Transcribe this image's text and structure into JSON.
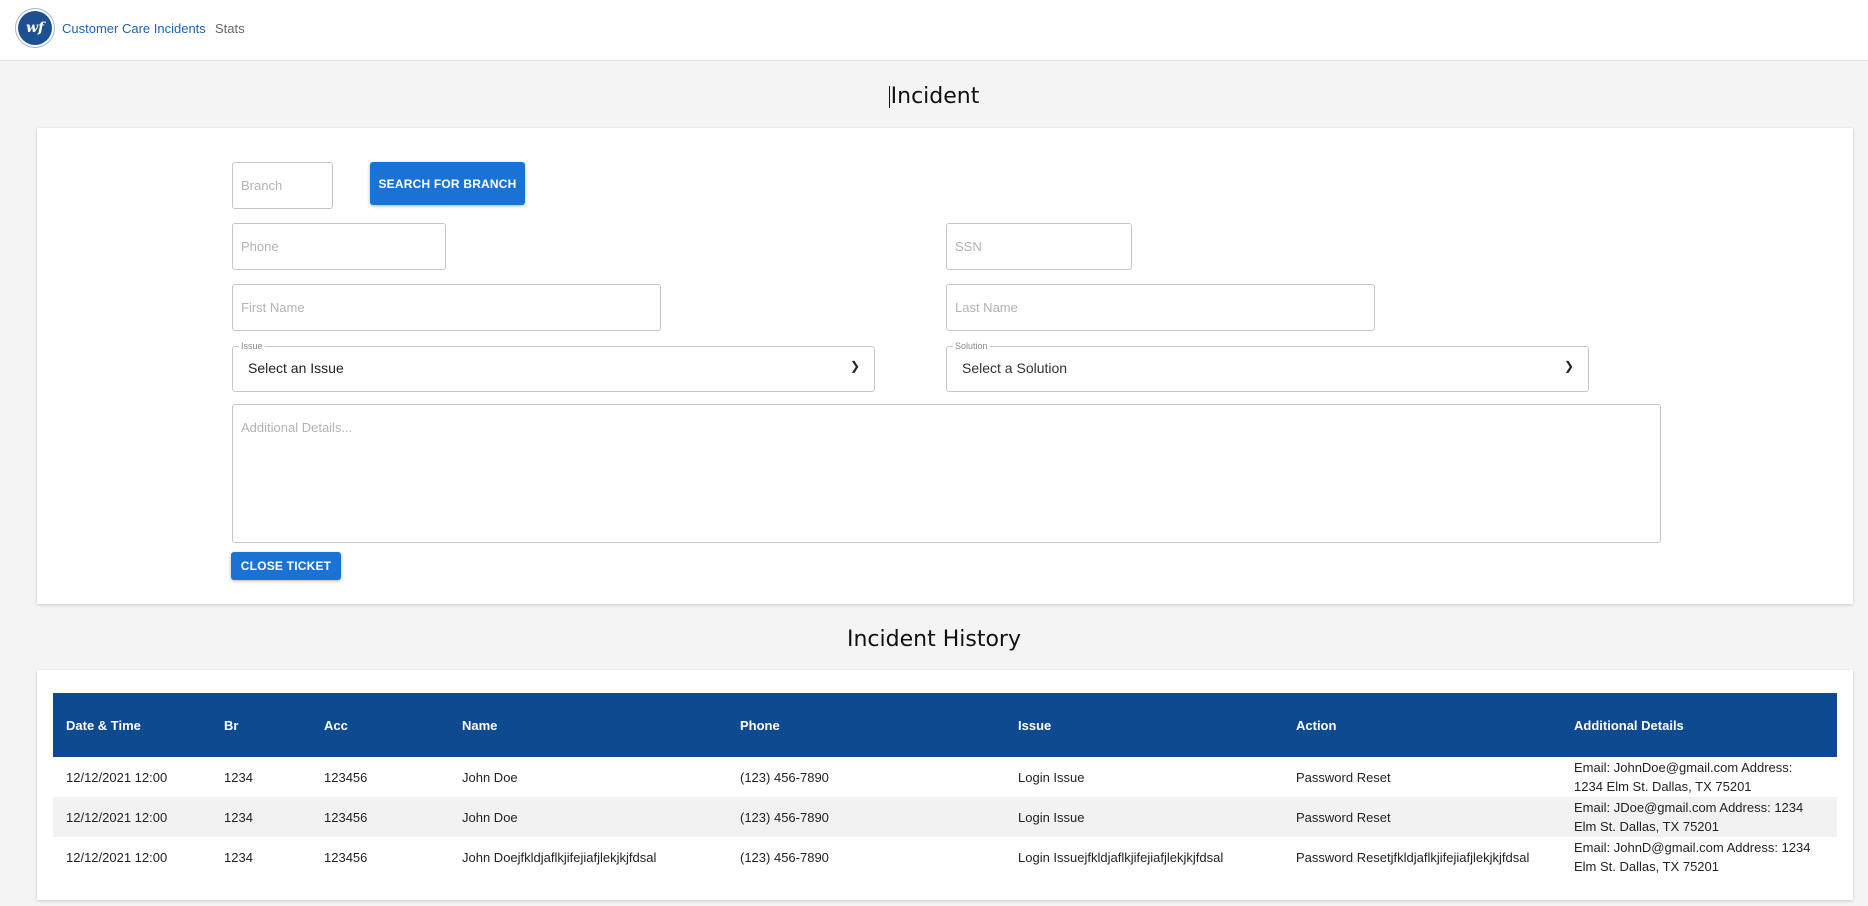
{
  "nav": {
    "logo_text": "wf",
    "primary": "Customer Care Incidents",
    "secondary": "Stats"
  },
  "incident": {
    "title": "Incident",
    "branch_placeholder": "Branch",
    "search_button": "SEARCH FOR BRANCH",
    "phone_placeholder": "Phone",
    "ssn_placeholder": "SSN",
    "first_name_placeholder": "First Name",
    "last_name_placeholder": "Last Name",
    "issue": {
      "legend": "Issue",
      "value": "Select an Issue"
    },
    "solution": {
      "legend": "Solution",
      "value": "Select a Solution"
    },
    "details_placeholder": "Additional Details...",
    "close_button": "CLOSE TICKET"
  },
  "history": {
    "title": "Incident History",
    "headers": [
      "Date & Time",
      "Br",
      "Acc",
      "Name",
      "Phone",
      "Issue",
      "Action",
      "Additional Details"
    ],
    "rows": [
      [
        "12/12/2021 12:00",
        "1234",
        "123456",
        "John Doe",
        "(123) 456-7890",
        "Login Issue",
        "Password Reset",
        "Email: JohnDoe@gmail.com Address: 1234 Elm St. Dallas, TX 75201"
      ],
      [
        "12/12/2021 12:00",
        "1234",
        "123456",
        "John Doe",
        "(123) 456-7890",
        "Login Issue",
        "Password Reset",
        "Email: JDoe@gmail.com Address: 1234 Elm St. Dallas, TX 75201"
      ],
      [
        "12/12/2021 12:00",
        "1234",
        "123456",
        "John Doejfkldjaflkjifejiafjlekjkjfdsal",
        "(123) 456-7890",
        "Login Issuejfkldjaflkjifejiafjlekjkjfdsal",
        "Password Resetjfkldjaflkjifejiafjlekjkjfdsal",
        "Email: JohnD@gmail.com Address: 1234 Elm St. Dallas, TX 75201"
      ]
    ]
  },
  "colors": {
    "accent": "#1a73d4",
    "header": "#0e4a8f",
    "nav_link": "#1a63b5"
  }
}
